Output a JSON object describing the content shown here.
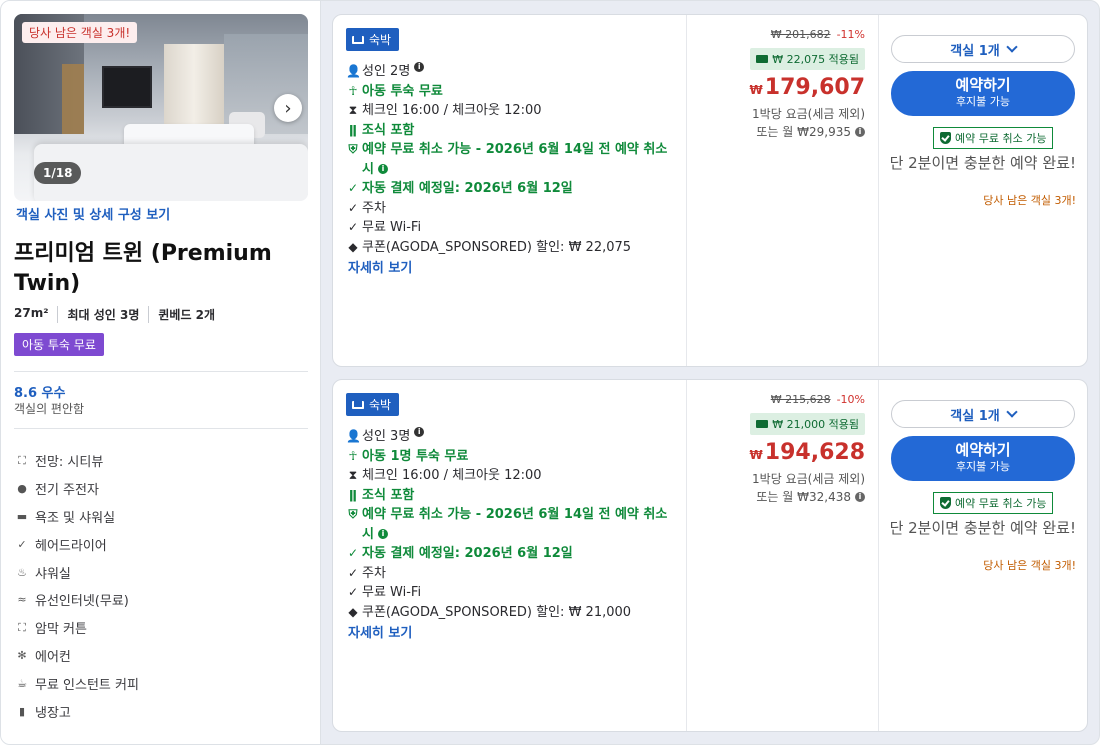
{
  "room": {
    "photo_badge": "당사 남은 객실 3개!",
    "photo_counter": "1/18",
    "photos_link": "객실 사진 및 상세 구성 보기",
    "title": "프리미엄 트윈 (Premium Twin)",
    "specs": [
      "27m²",
      "최대 성인 3명",
      "퀸베드 2개"
    ],
    "kids_tag": "아동 투숙 무료",
    "rating_score": "8.6 우수",
    "rating_sub": "객실의 편안함",
    "amenities": [
      {
        "icon": "view-icon",
        "label": "전망: 시티뷰"
      },
      {
        "icon": "ev-charger-icon",
        "label": "전기 주전자"
      },
      {
        "icon": "bathtub-icon",
        "label": "욕조 및 샤워실"
      },
      {
        "icon": "check-icon",
        "label": "헤어드라이어"
      },
      {
        "icon": "shower-icon",
        "label": "샤워실"
      },
      {
        "icon": "wifi-icon",
        "label": "유선인터넷(무료)"
      },
      {
        "icon": "curtain-icon",
        "label": "암막 커튼"
      },
      {
        "icon": "ac-icon",
        "label": "에어컨"
      },
      {
        "icon": "coffee-icon",
        "label": "무료 인스턴트 커피"
      },
      {
        "icon": "fridge-icon",
        "label": "냉장고"
      }
    ]
  },
  "offers": [
    {
      "tag": "숙박",
      "features": {
        "guests": "성인 2명",
        "kids": "아동 투숙 무료",
        "checkin": "체크인 16:00 / 체크아웃 12:00",
        "breakfast": "조식 포함",
        "cancel": "예약 무료 취소 가능 - 2026년 6월 14일 전 예약 취소 시",
        "autopay": "자동 결제 예정일: 2026년 6월 12일",
        "parking": "주차",
        "wifi": "무료 Wi-Fi",
        "coupon": "쿠폰(AGODA_SPONSORED) 할인: ₩ 22,075",
        "more": "자세히 보기"
      },
      "original_price": "₩ 201,682",
      "discount_pct": "-11%",
      "coupon_applied": "₩ 22,075 적용됨",
      "currency": "₩",
      "price": "179,607",
      "price_note": "1박당 요금(세금 제외)",
      "monthly": "또는 월 ₩29,935",
      "rooms_select": "객실 1개",
      "book_label": "예약하기",
      "book_sub": "후지불 가능",
      "free_cancel": "예약 무료 취소 가능",
      "urgency": "단 2분이면 충분한 예약 완료!",
      "left": "당사 남은 객실 3개!"
    },
    {
      "tag": "숙박",
      "features": {
        "guests": "성인 3명",
        "kids": "아동 1명 투숙 무료",
        "checkin": "체크인 16:00 / 체크아웃 12:00",
        "breakfast": "조식 포함",
        "cancel": "예약 무료 취소 가능 - 2026년 6월 14일 전 예약 취소 시",
        "autopay": "자동 결제 예정일: 2026년 6월 12일",
        "parking": "주차",
        "wifi": "무료 Wi-Fi",
        "coupon": "쿠폰(AGODA_SPONSORED) 할인: ₩ 21,000",
        "more": "자세히 보기"
      },
      "original_price": "₩ 215,628",
      "discount_pct": "-10%",
      "coupon_applied": "₩ 21,000 적용됨",
      "currency": "₩",
      "price": "194,628",
      "price_note": "1박당 요금(세금 제외)",
      "monthly": "또는 월 ₩32,438",
      "rooms_select": "객실 1개",
      "book_label": "예약하기",
      "book_sub": "후지불 가능",
      "free_cancel": "예약 무료 취소 가능",
      "urgency": "단 2분이면 충분한 예약 완료!",
      "left": "당사 남은 객실 3개!"
    }
  ]
}
